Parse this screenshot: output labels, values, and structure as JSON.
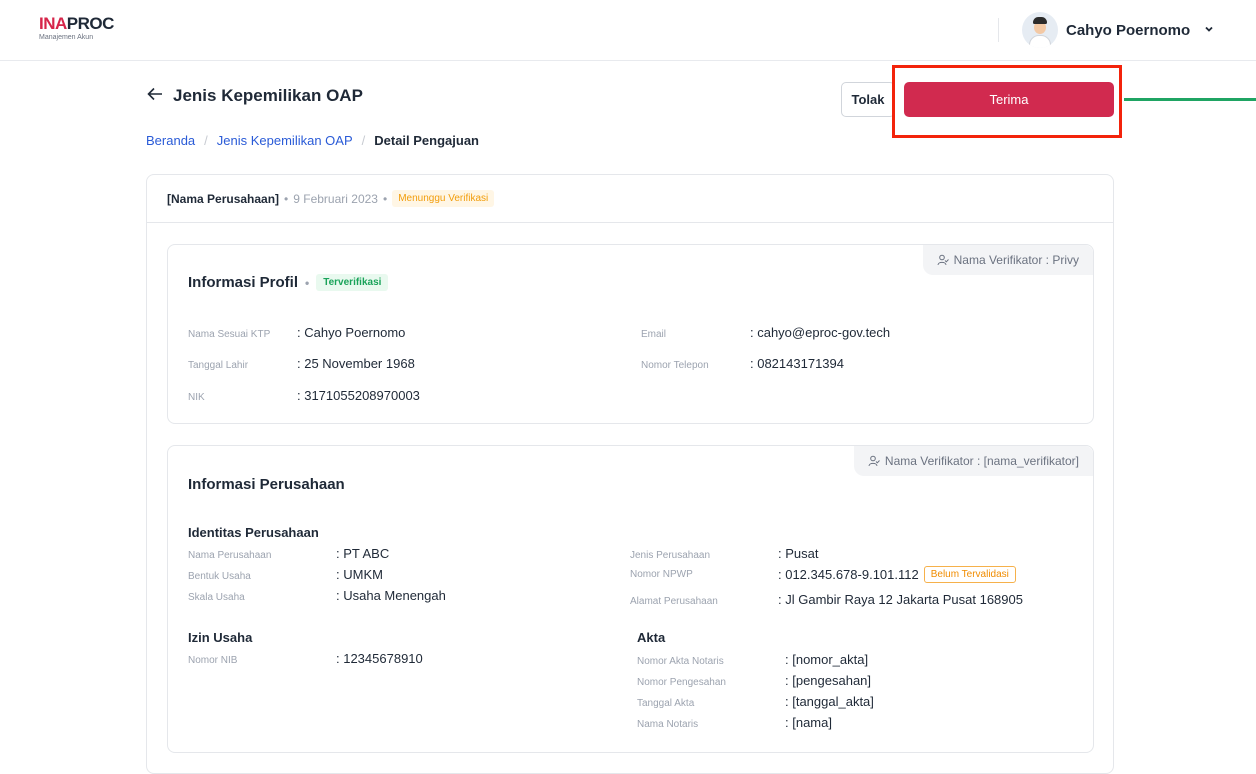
{
  "app": {
    "logo_prefix": "INA",
    "logo_suffix": "PROC",
    "logo_subtitle": "Manajemen Akun"
  },
  "user": {
    "name": "Cahyo Poernomo"
  },
  "page": {
    "title": "Jenis Kepemilikan OAP",
    "tolak_label": "Tolak",
    "terima_label": "Terima"
  },
  "breadcrumb": [
    "Beranda",
    "Jenis Kepemilikan OAP",
    "Detail Pengajuan"
  ],
  "submission": {
    "company": "[Nama Perusahaan]",
    "date": "9 Februari 2023",
    "status": "Menunggu Verifikasi"
  },
  "profile": {
    "title": "Informasi Profil",
    "status": "Terverifikasi",
    "verifier": "Nama Verifikator : Privy",
    "fields_left": [
      {
        "label": "Nama Sesuai KTP",
        "value": ": Cahyo Poernomo"
      },
      {
        "label": "Tanggal Lahir",
        "value": ": 25 November 1968"
      },
      {
        "label": "NIK",
        "value": ": 3171055208970003"
      }
    ],
    "fields_right": [
      {
        "label": "Email",
        "value": ": cahyo@eproc-gov.tech"
      },
      {
        "label": "Nomor Telepon",
        "value": ": 082143171394"
      }
    ]
  },
  "company": {
    "title": "Informasi Perusahaan",
    "verifier": "Nama Verifikator : [nama_verifikator]",
    "identitas_title": "Identitas Perusahaan",
    "identitas_left": [
      {
        "label": "Nama Perusahaan",
        "value": ": PT ABC"
      },
      {
        "label": "Bentuk Usaha",
        "value": ": UMKM"
      },
      {
        "label": "Skala Usaha",
        "value": ": Usaha Menengah"
      }
    ],
    "identitas_right": [
      {
        "label": "Jenis Perusahaan",
        "value": ": Pusat"
      },
      {
        "label": "Nomor NPWP",
        "value": ": 012.345.678-9.101.112",
        "badge": "Belum Tervalidasi"
      },
      {
        "label": "Alamat Perusahaan",
        "value": ": Jl Gambir Raya 12 Jakarta Pusat 168905"
      }
    ],
    "izin_title": "Izin Usaha",
    "izin": [
      {
        "label": "Nomor NIB",
        "value": ": 12345678910"
      }
    ],
    "akta_title": "Akta",
    "akta": [
      {
        "label": "Nomor Akta Notaris",
        "value": ": [nomor_akta]"
      },
      {
        "label": "Nomor Pengesahan",
        "value": ": [pengesahan]"
      },
      {
        "label": "Tanggal Akta",
        "value": ": [tanggal_akta]"
      },
      {
        "label": "Nama Notaris",
        "value": ": [nama]"
      }
    ]
  },
  "colors": {
    "accent": "#d12a4f",
    "highlight": "#f3230b",
    "arrow": "#1fa463",
    "link": "#2a5bd7"
  }
}
